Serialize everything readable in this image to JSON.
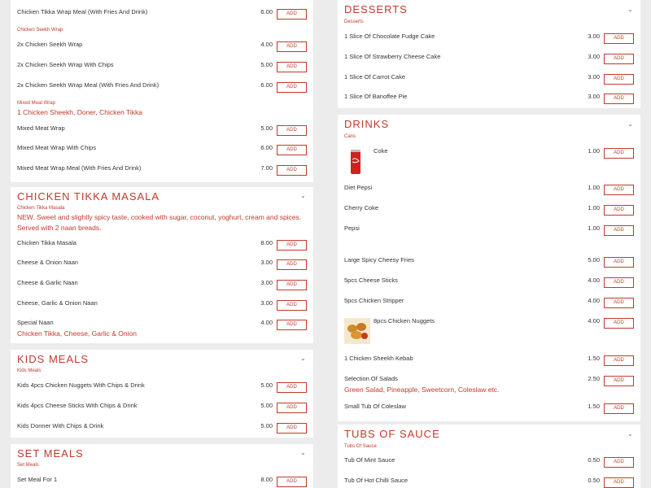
{
  "left": {
    "top_items": [
      {
        "name": "Chicken Tikka Wrap Meal (With Fries And Drink)",
        "price": "6.00",
        "add": "ADD"
      }
    ],
    "chicken_seekh": {
      "subheading": "Chicken Seekh Wrap",
      "items": [
        {
          "name": "2x Chicken Seekh Wrap",
          "price": "4.00",
          "add": "ADD"
        },
        {
          "name": "2x Chicken Seekh Wrap With Chips",
          "price": "5.00",
          "add": "ADD"
        },
        {
          "name": "2x Chicken Seekh Wrap Meal (With Fries And Drink)",
          "price": "6.00",
          "add": "ADD"
        }
      ]
    },
    "mixed_meat": {
      "subheading": "Mixed Meat Wrap",
      "description": "1 Chicken Sheekh, Doner, Chicken Tikka",
      "items": [
        {
          "name": "Mixed Meat Wrap",
          "price": "5.00",
          "add": "ADD"
        },
        {
          "name": "Mixed Meat Wrap With Chips",
          "price": "6.00",
          "add": "ADD"
        },
        {
          "name": "Mixed Meat Wrap Meal (With Fries And Drink)",
          "price": "7.00",
          "add": "ADD"
        }
      ]
    },
    "tikka_masala": {
      "title": "CHICKEN TIKKA MASALA",
      "subheading": "Chicken Tikka Masala",
      "description": "NEW. Sweet and slightly spicy taste, cooked with sugar, coconut, yoghurt, cream and spices. Served with 2 naan breads.",
      "items": [
        {
          "name": "Chicken Tikka Masala",
          "price": "8.00",
          "add": "ADD"
        },
        {
          "name": "Cheese & Onion Naan",
          "price": "3.00",
          "add": "ADD"
        },
        {
          "name": "Cheese & Garlic Naan",
          "price": "3.00",
          "add": "ADD"
        },
        {
          "name": "Cheese, Garlic & Onion Naan",
          "price": "3.00",
          "add": "ADD"
        },
        {
          "name": "Special Naan",
          "price": "4.00",
          "add": "ADD",
          "extra": "Chicken Tikka, Cheese, Garlic & Onion"
        }
      ]
    },
    "kids_meals": {
      "title": "KIDS MEALS",
      "subheading": "Kids Meals",
      "items": [
        {
          "name": "Kids 4pcs Chicken Nuggets With Chips & Drink",
          "price": "5.00",
          "add": "ADD"
        },
        {
          "name": "Kids 4pcs Cheese Sticks With Chips & Drink",
          "price": "5.00",
          "add": "ADD"
        },
        {
          "name": "Kids Donner With Chips & Drink",
          "price": "5.00",
          "add": "ADD"
        }
      ]
    },
    "set_meals": {
      "title": "SET MEALS",
      "subheading": "Set Meals",
      "items": [
        {
          "name": "Set Meal For 1",
          "price": "8.00",
          "add": "ADD"
        }
      ]
    }
  },
  "right": {
    "desserts": {
      "title": "DESSERTS",
      "subheading": "Desserts",
      "items": [
        {
          "name": "1 Slice Of Chocolate Fudge Cake",
          "price": "3.00",
          "add": "ADD"
        },
        {
          "name": "1 Slice Of Strawberry Cheese Cake",
          "price": "3.00",
          "add": "ADD"
        },
        {
          "name": "1 Slice Of Carrot Cake",
          "price": "3.00",
          "add": "ADD"
        },
        {
          "name": "1 Slice Of Banoffee Pie",
          "price": "3.00",
          "add": "ADD"
        }
      ]
    },
    "drinks": {
      "title": "DRINKS",
      "subheading": "Cans",
      "items": [
        {
          "name": "Coke",
          "price": "1.00",
          "add": "ADD"
        },
        {
          "name": "Diet Pepsi",
          "price": "1.00",
          "add": "ADD"
        },
        {
          "name": "Cherry Coke",
          "price": "1.00",
          "add": "ADD"
        },
        {
          "name": "Pepsi",
          "price": "1.00",
          "add": "ADD"
        }
      ]
    },
    "sides": {
      "items": [
        {
          "name": "Large Spicy Cheesy Fries",
          "price": "5.00",
          "add": "ADD"
        },
        {
          "name": "5pcs Cheese Sticks",
          "price": "4.00",
          "add": "ADD"
        },
        {
          "name": "5pcs Chicken Stripper",
          "price": "4.00",
          "add": "ADD"
        },
        {
          "name": "8pcs Chicken Nuggets",
          "price": "4.00",
          "add": "ADD"
        },
        {
          "name": "1 Chicken Sheekh Kebab",
          "price": "1.50",
          "add": "ADD"
        },
        {
          "name": "Selection Of Salads",
          "price": "2.50",
          "add": "ADD",
          "extra": "Green Salad, Pineapple, Sweetcorn, Coleslaw etc."
        },
        {
          "name": "Small Tub Of Coleslaw",
          "price": "1.50",
          "add": "ADD"
        }
      ]
    },
    "sauces": {
      "title": "TUBS OF SAUCE",
      "subheading": "Tubs Of Sauce",
      "items": [
        {
          "name": "Tub Of Mint Sauce",
          "price": "0.50",
          "add": "ADD"
        },
        {
          "name": "Tub Of Hot Chilli Sauce",
          "price": "0.50",
          "add": "ADD"
        }
      ]
    }
  },
  "colors": {
    "accent": "#c0392b",
    "background": "#ececec",
    "panel": "#ffffff"
  },
  "icons": {
    "chevron": "chevron-down-icon"
  }
}
